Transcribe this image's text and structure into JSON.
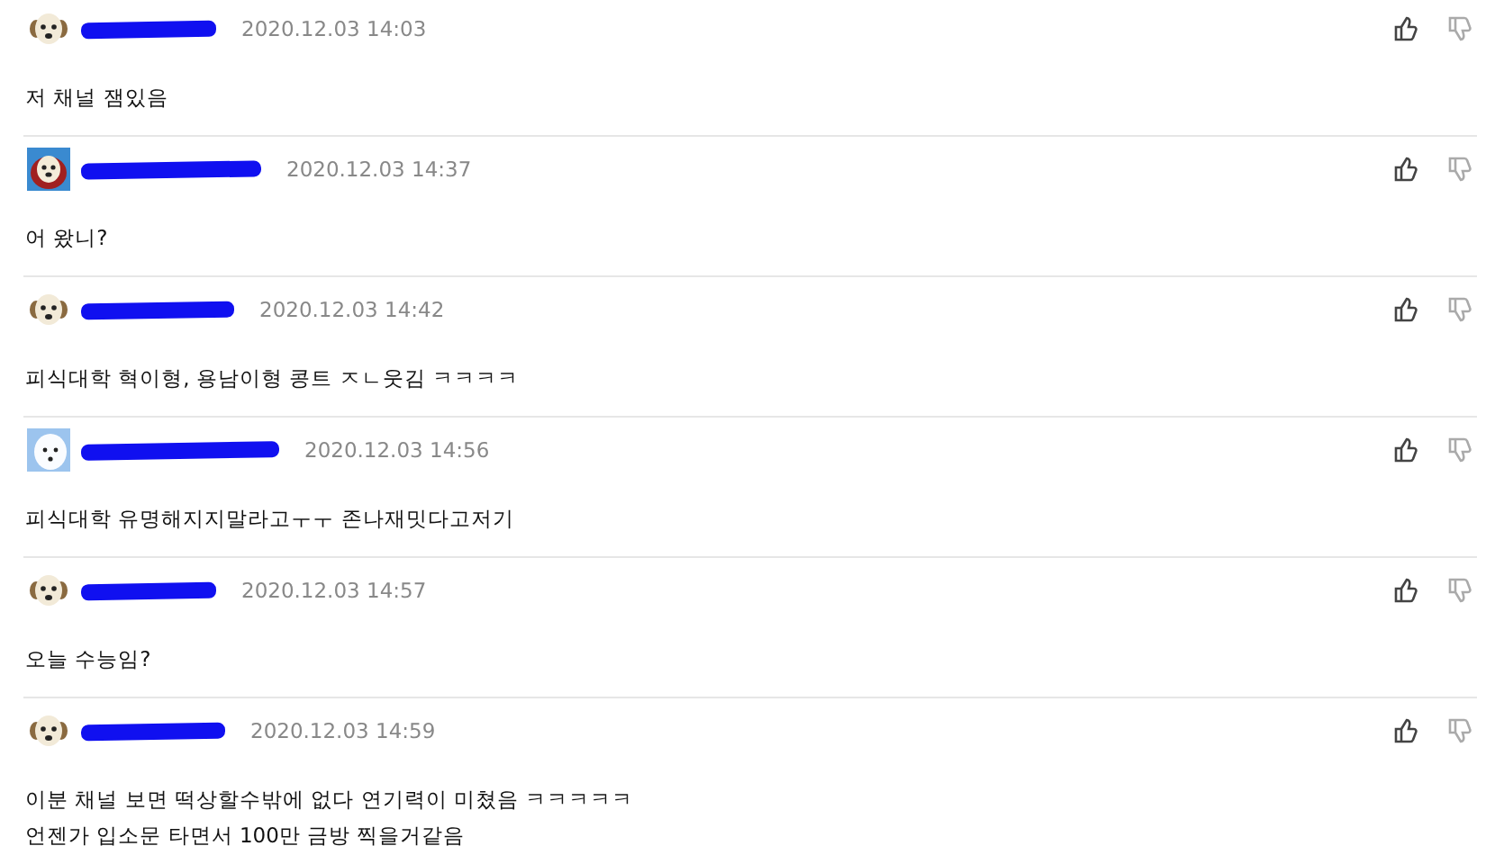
{
  "comments": [
    {
      "kind": "puppy",
      "time": "2020.12.03 14:03",
      "lines": [
        "저 채널 잼있음"
      ]
    },
    {
      "kind": "framed",
      "time": "2020.12.03 14:37",
      "lines": [
        "어 왔니?"
      ]
    },
    {
      "kind": "puppy",
      "time": "2020.12.03 14:42",
      "lines": [
        "피식대학 혁이형, 용남이형 콩트 ㅈㄴ웃김 ㅋㅋㅋㅋ"
      ]
    },
    {
      "kind": "white",
      "time": "2020.12.03 14:56",
      "lines": [
        "피식대학 유명해지지말라고ㅜㅜ 존나재밋다고저기"
      ]
    },
    {
      "kind": "puppy",
      "time": "2020.12.03 14:57",
      "lines": [
        "오늘 수능임?"
      ]
    },
    {
      "kind": "puppy",
      "time": "2020.12.03 14:59",
      "lines": [
        "이분 채널 보면 떡상할수밖에 없다 연기력이 미쳤음 ㅋㅋㅋㅋㅋ",
        "언젠가 입소문 타면서 100만 금방 찍을거같음"
      ]
    }
  ]
}
